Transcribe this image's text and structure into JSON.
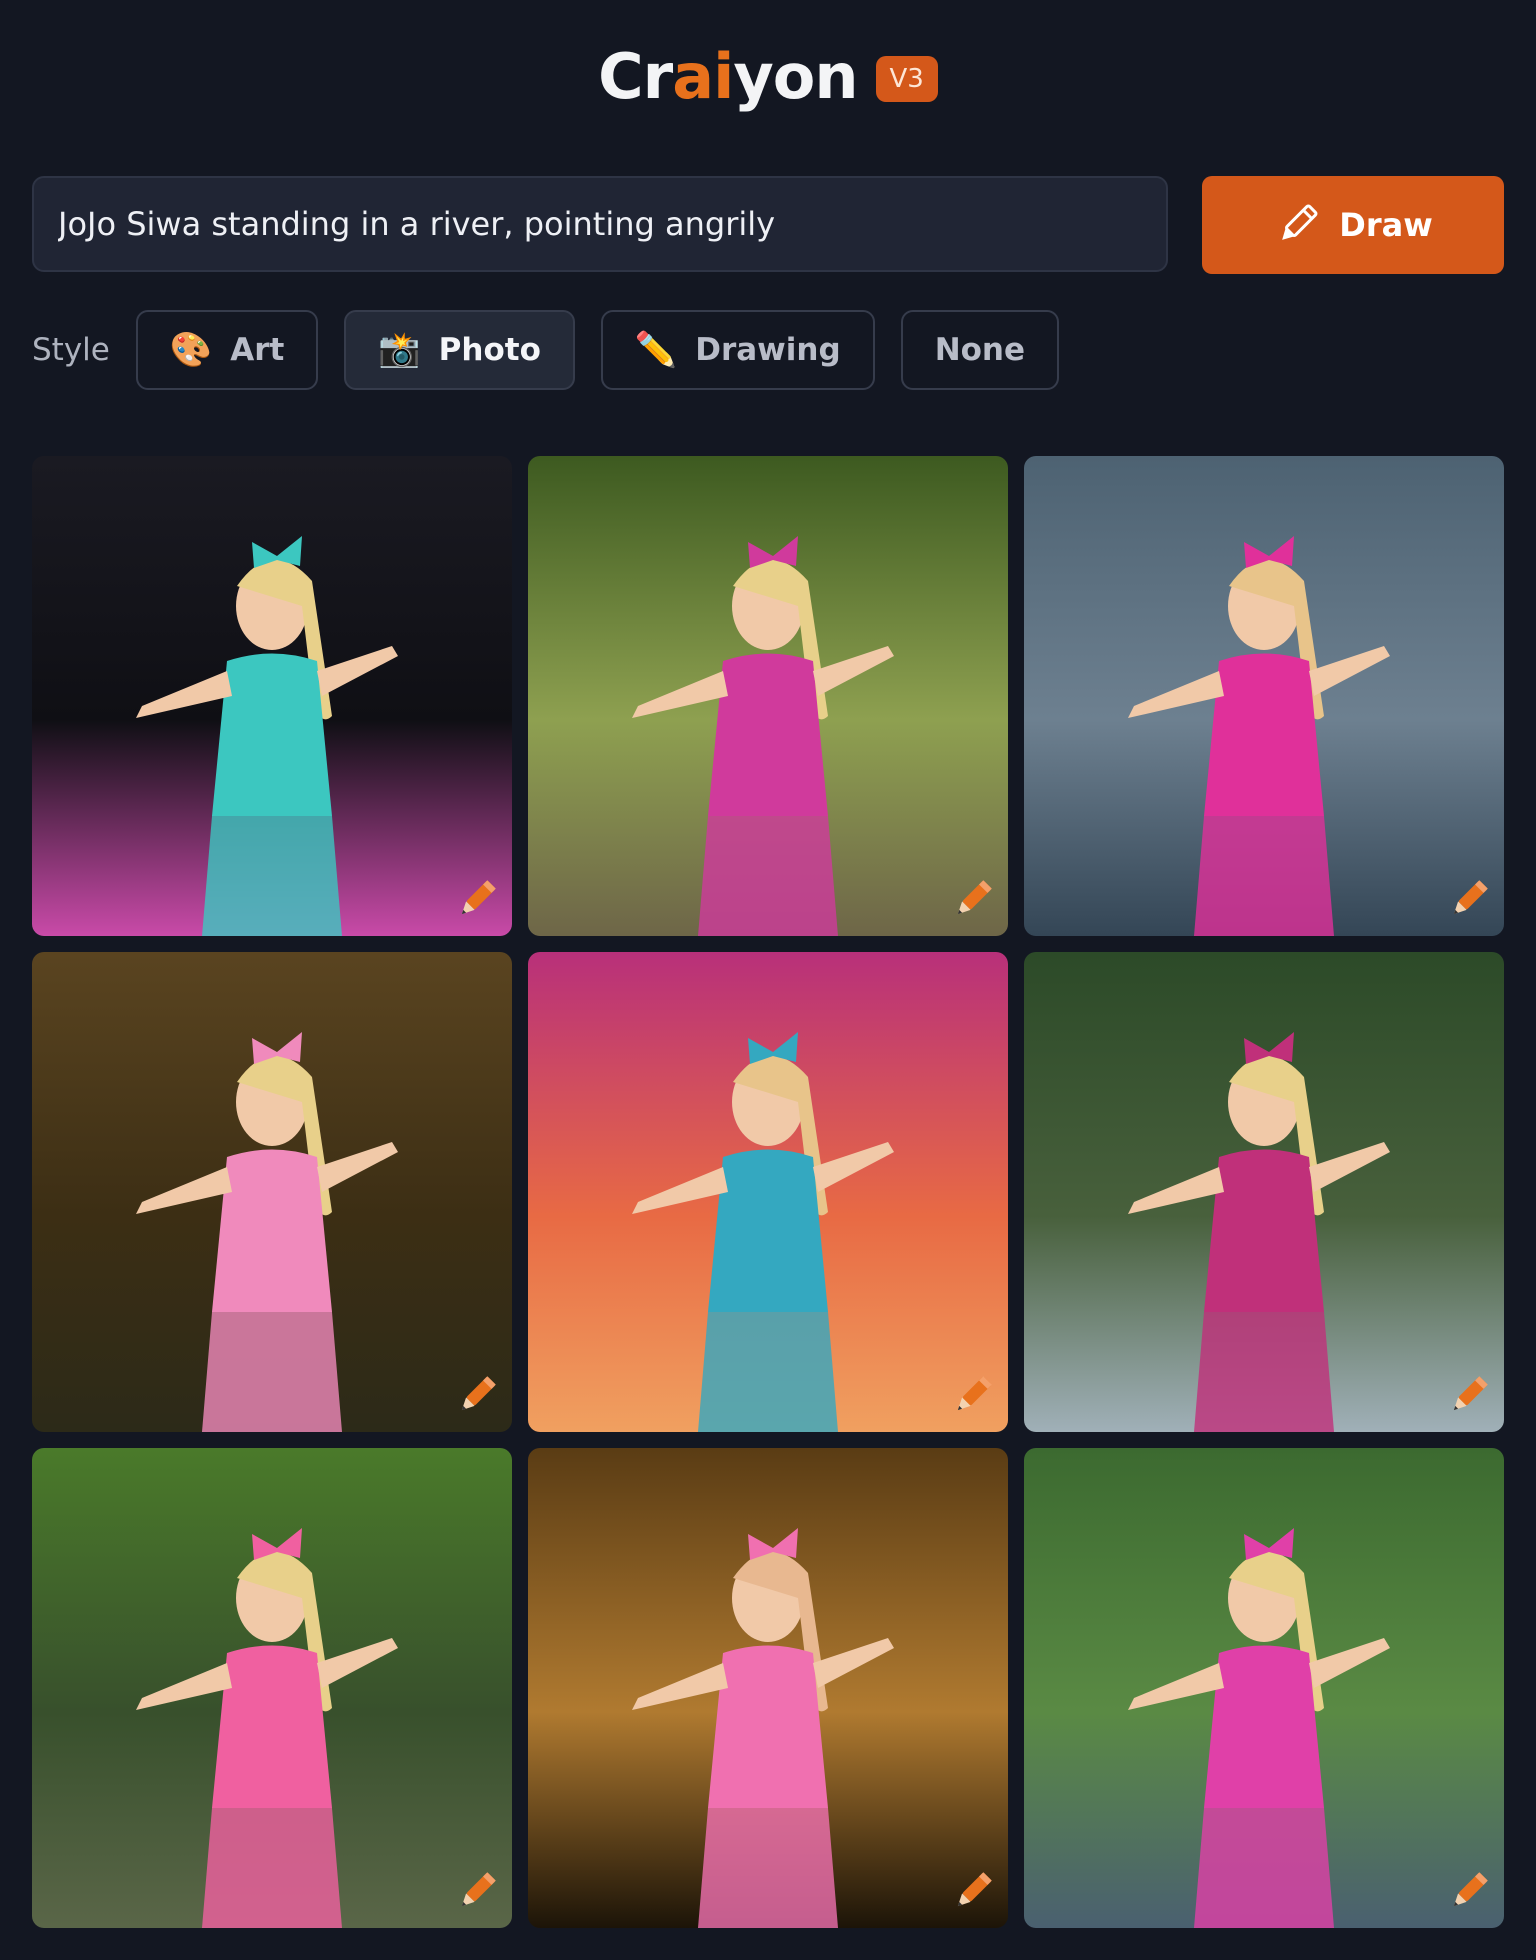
{
  "header": {
    "logo_left": "Cr",
    "logo_mid": "ai",
    "logo_right": "yon",
    "version": "V3"
  },
  "prompt": {
    "value": "JoJo Siwa standing in a river, pointing angrily",
    "draw_label": "Draw"
  },
  "styles": {
    "label": "Style",
    "options": [
      {
        "label": "Art",
        "icon": "palette-icon",
        "glyph": "🎨",
        "active": false
      },
      {
        "label": "Photo",
        "icon": "camera-flash-icon",
        "glyph": "📸",
        "active": true
      },
      {
        "label": "Drawing",
        "icon": "pencil-icon",
        "glyph": "✏️",
        "active": false
      },
      {
        "label": "None",
        "icon": "",
        "glyph": "",
        "active": false
      }
    ]
  },
  "colors": {
    "accent": "#d4581a",
    "background": "#131722",
    "logo_ai": "#e8711c"
  },
  "images": [
    {
      "scene": "dark-studio",
      "colors": [
        "#1a1a22",
        "#0f0f14",
        "#c94aa8",
        "#3cc7c0",
        "#e8d08a"
      ]
    },
    {
      "scene": "river-forest",
      "colors": [
        "#3d5a20",
        "#8ea050",
        "#6e6648",
        "#d03a9c",
        "#e8d08a"
      ]
    },
    {
      "scene": "river-water",
      "colors": [
        "#4d6272",
        "#6d8090",
        "#344656",
        "#e0309a",
        "#e8c48a"
      ]
    },
    {
      "scene": "brown-river",
      "colors": [
        "#5a4420",
        "#3c2e14",
        "#2c2a18",
        "#f08abc",
        "#e8d08a"
      ]
    },
    {
      "scene": "pink-orange-studio",
      "colors": [
        "#b8307a",
        "#e86a44",
        "#f0a060",
        "#34a8c0",
        "#e8c48a"
      ]
    },
    {
      "scene": "river-rapids",
      "colors": [
        "#2c4a28",
        "#48603c",
        "#a0b0b8",
        "#c0307a",
        "#e8d08a"
      ]
    },
    {
      "scene": "green-river",
      "colors": [
        "#4a7a2a",
        "#38502c",
        "#5a6648",
        "#f060a0",
        "#e8d08a"
      ]
    },
    {
      "scene": "golden-dark",
      "colors": [
        "#5a3c14",
        "#b07a30",
        "#1c1408",
        "#f070b0",
        "#e8b890"
      ]
    },
    {
      "scene": "forest-river-blur",
      "colors": [
        "#3c6a30",
        "#5a8a44",
        "#4a6070",
        "#e040a8",
        "#e8d08a"
      ]
    }
  ]
}
